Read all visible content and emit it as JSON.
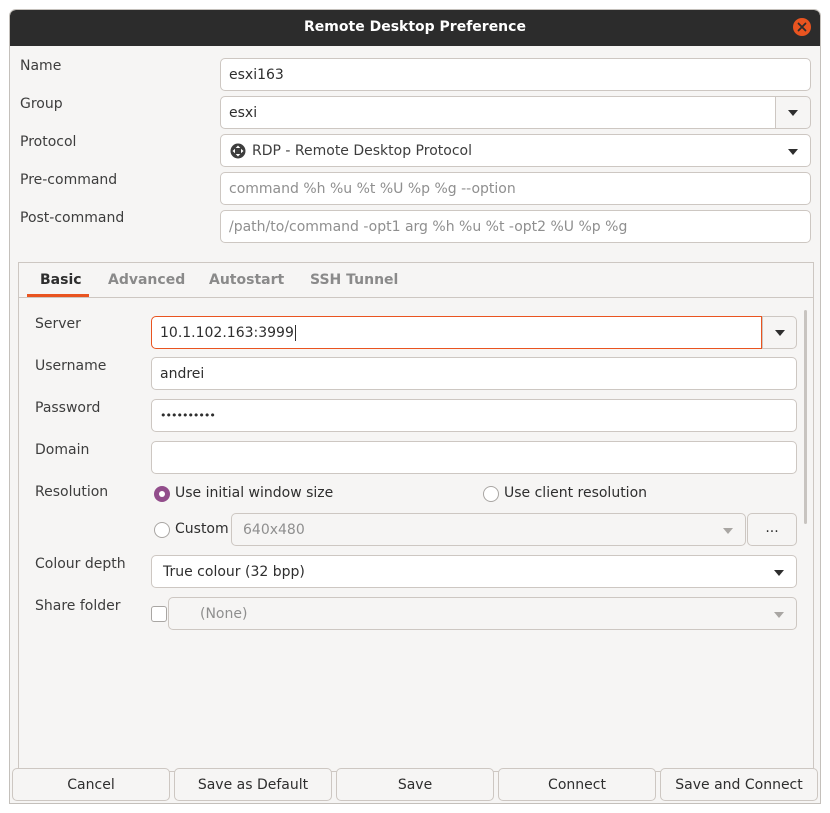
{
  "window": {
    "title": "Remote Desktop Preference"
  },
  "form": {
    "name": {
      "label": "Name",
      "value": "esxi163"
    },
    "group": {
      "label": "Group",
      "value": "esxi"
    },
    "protocol": {
      "label": "Protocol",
      "value": "RDP - Remote Desktop Protocol"
    },
    "precommand": {
      "label": "Pre-command",
      "placeholder": "command %h %u %t %U %p %g --option"
    },
    "postcommand": {
      "label": "Post-command",
      "placeholder": "/path/to/command -opt1 arg %h %u %t -opt2 %U %p %g"
    }
  },
  "tabs": [
    {
      "label": "Basic",
      "active": true
    },
    {
      "label": "Advanced",
      "active": false
    },
    {
      "label": "Autostart",
      "active": false
    },
    {
      "label": "SSH Tunnel",
      "active": false
    }
  ],
  "basic": {
    "server": {
      "label": "Server",
      "value": "10.1.102.163:3999"
    },
    "username": {
      "label": "Username",
      "value": "andrei"
    },
    "password": {
      "label": "Password",
      "value": "••••••••••"
    },
    "domain": {
      "label": "Domain",
      "value": ""
    },
    "resolution": {
      "label": "Resolution",
      "option_initial": "Use initial window size",
      "option_client": "Use client resolution",
      "option_custom": "Custom",
      "custom_value": "640x480",
      "custom_button": "...",
      "selected": "initial"
    },
    "colour_depth": {
      "label": "Colour depth",
      "value": "True colour (32 bpp)"
    },
    "share_folder": {
      "label": "Share folder",
      "value": "(None)",
      "checked": false
    }
  },
  "buttons": {
    "cancel": "Cancel",
    "save_default": "Save as Default",
    "save": "Save",
    "connect": "Connect",
    "save_connect": "Save and Connect"
  },
  "colors": {
    "accent": "#e95420",
    "radio_selected": "#924d8b",
    "titlebar": "#2c2c2c"
  }
}
